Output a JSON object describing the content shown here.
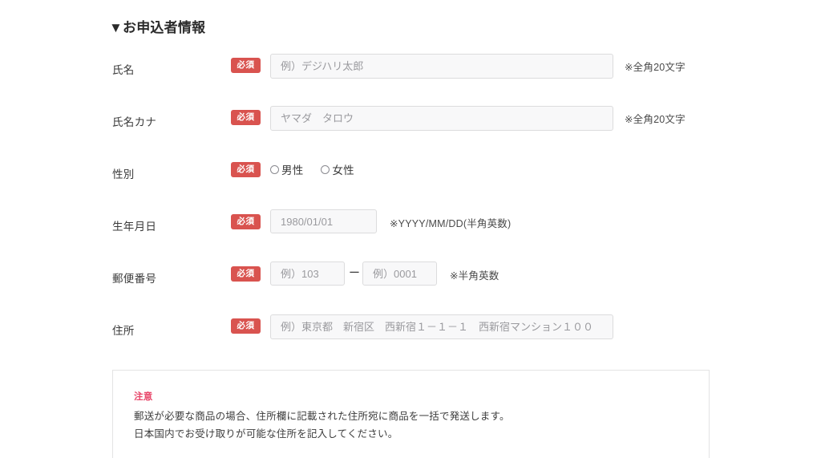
{
  "section": {
    "heading": "▼お申込者情報"
  },
  "form": {
    "required_badge": "必須",
    "rows": [
      {
        "label": "氏名",
        "placeholder": "例）デジハリ太郎",
        "hint": "※全角20文字"
      },
      {
        "label": "氏名カナ",
        "placeholder": "ヤマダ　タロウ",
        "hint": "※全角20文字"
      },
      {
        "label": "性別",
        "options": [
          {
            "label": "男性",
            "selected": false
          },
          {
            "label": "女性",
            "selected": false
          }
        ]
      },
      {
        "label": "生年月日",
        "placeholder": "1980/01/01",
        "hint": "※YYYY/MM/DD(半角英数)"
      },
      {
        "label": "郵便番号",
        "placeholder_zip1": "例）103",
        "separator": "ー",
        "placeholder_zip2": "例）0001",
        "hint": "※半角英数"
      },
      {
        "label": "住所",
        "placeholder": "例）東京都　新宿区　西新宿１－１－１　西新宿マンション１００"
      }
    ]
  },
  "notice": {
    "title": "注意",
    "line1": "郵送が必要な商品の場合、住所欄に記載された住所宛に商品を一括で発送します。",
    "line2": "日本国内でお受け取りが可能な住所を記入してください。"
  },
  "colors": {
    "required_badge_bg": "#d9534f",
    "notice_title": "#e8486b",
    "input_bg": "#f8f8f9",
    "input_border": "#dcdcdd",
    "page_bg": "#ffffff"
  }
}
